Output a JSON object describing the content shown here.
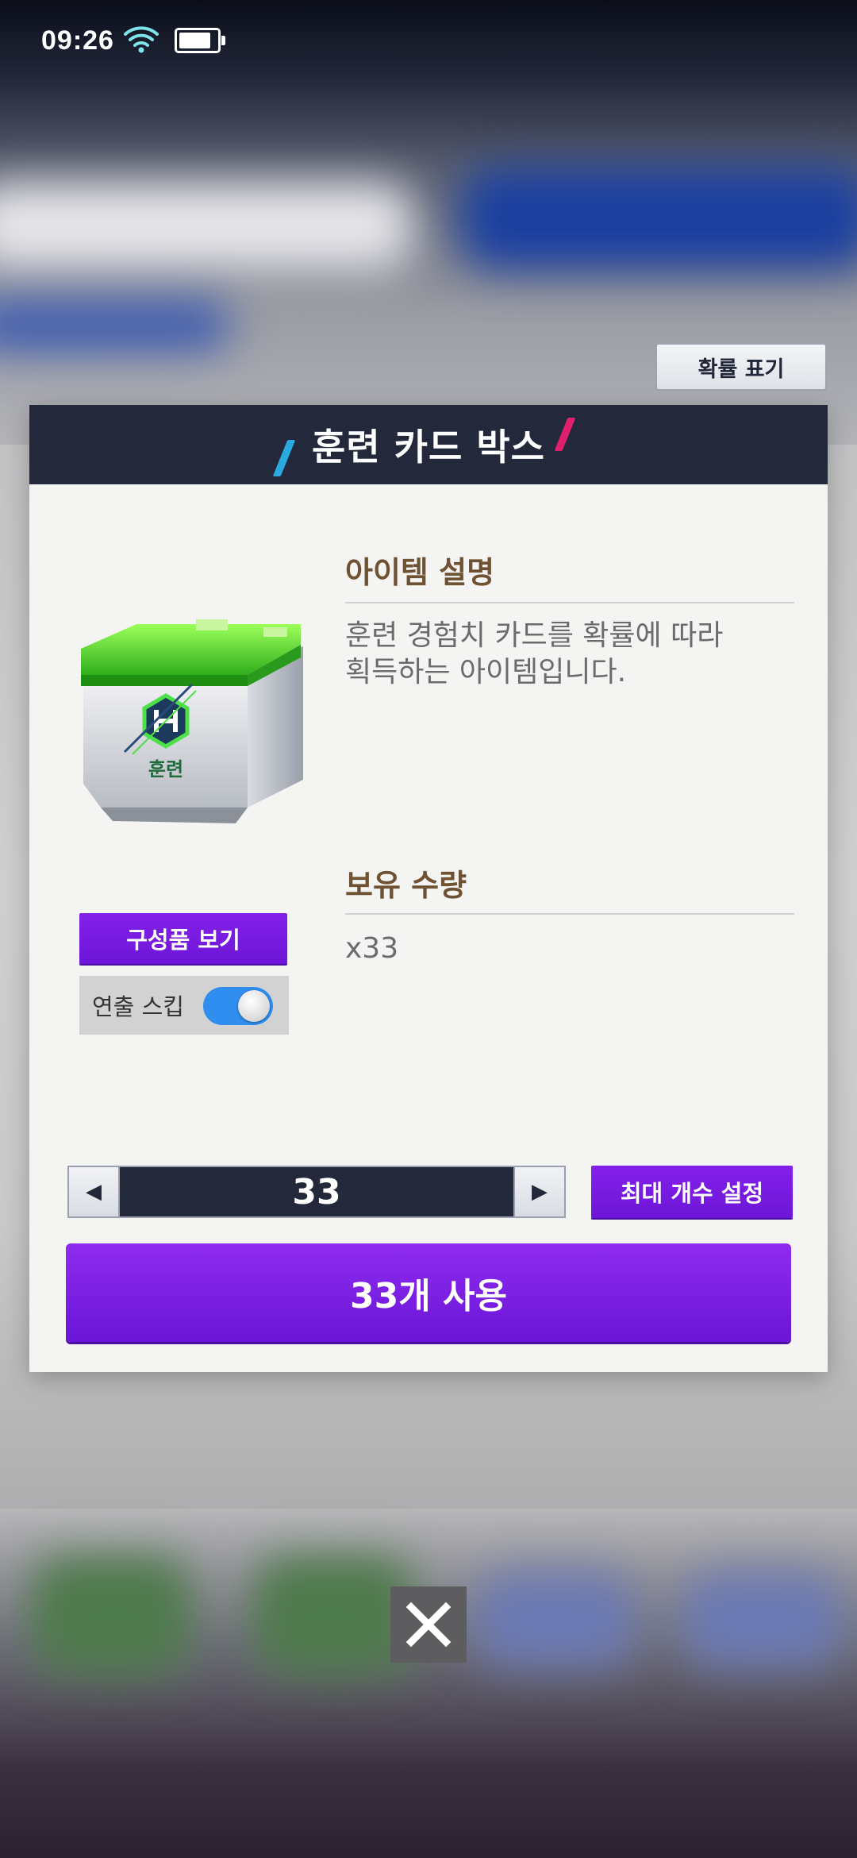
{
  "status_bar": {
    "time": "09:26",
    "battery_level": 0.85
  },
  "probability_button": {
    "label": "확률 표기"
  },
  "modal": {
    "title": "훈련 카드 박스",
    "item_image": {
      "label": "훈련",
      "icon_letter": "H"
    },
    "view_components_label": "구성품 보기",
    "skip_toggle": {
      "label": "연출 스킵",
      "on": true
    },
    "description": {
      "title": "아이템 설명",
      "line1": "훈련 경험치 카드를 확률에 따라",
      "line2": "획득하는 아이템입니다."
    },
    "holdings": {
      "title": "보유 수량",
      "value": "x33"
    },
    "quantity": {
      "value": "33"
    },
    "max_button_label": "최대 개수 설정",
    "use_button_label": "33개 사용"
  },
  "colors": {
    "header": "#23283a",
    "accent_purple": "#7b1fe6",
    "section_title": "#6f5233",
    "toggle_on": "#2f8ef0"
  }
}
